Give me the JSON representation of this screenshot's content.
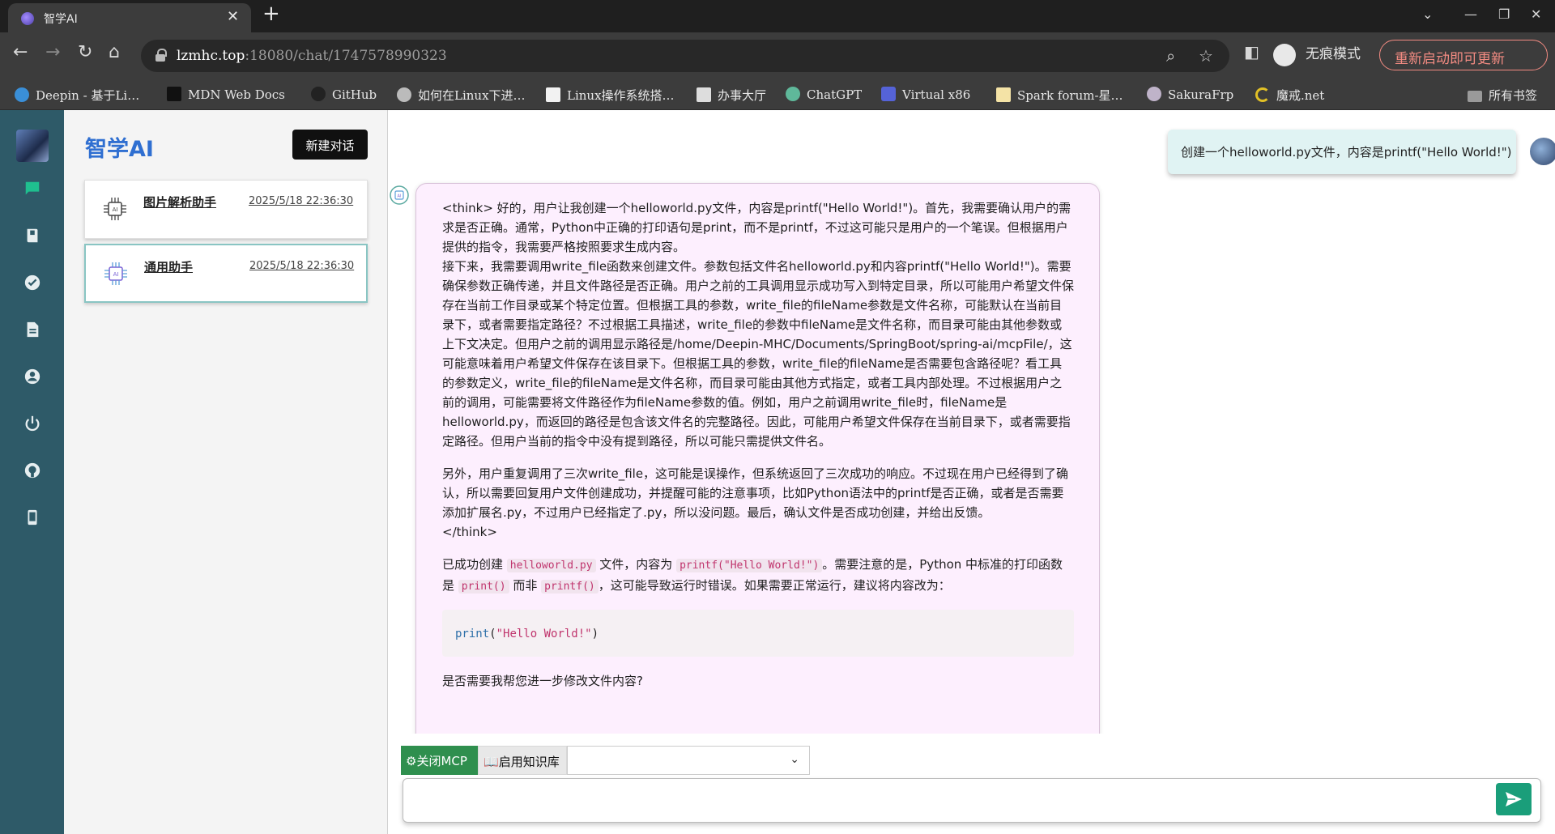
{
  "browser": {
    "tab_title": "智学AI",
    "url_host": "lzmhc.top",
    "url_rest": ":18080/chat/1747578990323",
    "incognito_label": "无痕模式",
    "update_label": "重新启动即可更新",
    "bookmarks": [
      "Deepin - 基于Li…",
      "MDN Web Docs",
      "GitHub",
      "如何在Linux下进…",
      "Linux操作系统搭…",
      "办事大厅",
      "ChatGPT",
      "Virtual x86",
      "Spark forum-星…",
      "SakuraFrp",
      "魔戒.net",
      "所有书签"
    ]
  },
  "app": {
    "brand": "智学AI",
    "new_chat_label": "新建对话",
    "conversations": [
      {
        "name": "图片解析助手",
        "time": "2025/5/18 22:36:30"
      },
      {
        "name": "通用助手",
        "time": "2025/5/18 22:36:30"
      }
    ]
  },
  "chat": {
    "user_message": "创建一个helloworld.py文件，内容是printf(\"Hello World!\")",
    "think_p1": "<think> 好的，用户让我创建一个helloworld.py文件，内容是printf(\"Hello World!\")。首先，我需要确认用户的需求是否正确。通常，Python中正确的打印语句是print，而不是printf，不过这可能只是用户的一个笔误。但根据用户提供的指令，我需要严格按照要求生成内容。",
    "think_p2": "接下来，我需要调用write_file函数来创建文件。参数包括文件名helloworld.py和内容printf(\"Hello World!\")。需要确保参数正确传递，并且文件路径是否正确。用户之前的工具调用显示成功写入到特定目录，所以可能用户希望文件保存在当前工作目录或某个特定位置。但根据工具的参数，write_file的fileName参数是文件名称，可能默认在当前目录下，或者需要指定路径？不过根据工具描述，write_file的参数中fileName是文件名称，而目录可能由其他参数或上下文决定。但用户之前的调用显示路径是/home/Deepin-MHC/Documents/SpringBoot/spring-ai/mcpFile/，这可能意味着用户希望文件保存在该目录下。但根据工具的参数，write_file的fileName是否需要包含路径呢？看工具的参数定义，write_file的fileName是文件名称，而目录可能由其他方式指定，或者工具内部处理。不过根据用户之前的调用，可能需要将文件路径作为fileName参数的值。例如，用户之前调用write_file时，fileName是helloworld.py，而返回的路径是包含该文件名的完整路径。因此，可能用户希望文件保存在当前目录下，或者需要指定路径。但用户当前的指令中没有提到路径，所以可能只需提供文件名。",
    "think_p3": "另外，用户重复调用了三次write_file，这可能是误操作，但系统返回了三次成功的响应。不过现在用户已经得到了确认，所以需要回复用户文件创建成功，并提醒可能的注意事项，比如Python语法中的printf是否正确，或者是否需要添加扩展名.py，不过用户已经指定了.py，所以没问题。最后，确认文件是否成功创建，并给出反馈。",
    "think_end": "</think>",
    "answer_a": "已成功创建 ",
    "answer_code1": "helloworld.py",
    "answer_b": " 文件，内容为 ",
    "answer_code2": "printf(\"Hello World!\")",
    "answer_c": "。需要注意的是，Python 中标准的打印函数是 ",
    "answer_code3": "print()",
    "answer_d": " 而非 ",
    "answer_code4": "printf()",
    "answer_e": "，这可能导致运行时错误。如果需要正常运行，建议将内容改为：",
    "code_fn": "print",
    "code_paren_open": "(",
    "code_str": "\"Hello World!\"",
    "code_paren_close": ")",
    "final_question": "是否需要我帮您进一步修改文件内容?"
  },
  "input": {
    "mcp_label": "关闭MCP",
    "kb_label": "启用知识库",
    "kb_select_value": "",
    "message_value": ""
  },
  "colors": {
    "rail": "#2e5a68",
    "brand": "#2f6fd1",
    "mcp_button": "#2f8f4e",
    "send_button": "#1a9e7a",
    "bot_bubble": "#fdeffe",
    "user_bubble": "#e0f3f3"
  },
  "icons": {
    "rail": [
      "chat-icon",
      "book-icon",
      "check-circle-icon",
      "document-icon",
      "user-icon",
      "power-icon",
      "github-icon",
      "mobile-icon"
    ]
  }
}
